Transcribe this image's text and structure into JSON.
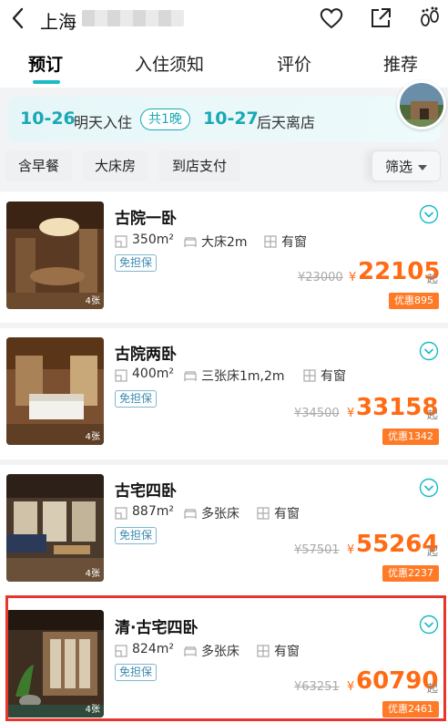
{
  "header": {
    "title": "上海",
    "icons": [
      "back-chevron-icon",
      "heart-icon",
      "share-icon",
      "footprint-icon"
    ]
  },
  "tabs": [
    {
      "label": "预订",
      "active": true
    },
    {
      "label": "入住须知",
      "active": false
    },
    {
      "label": "评价",
      "active": false
    },
    {
      "label": "推荐",
      "active": false
    }
  ],
  "dates": {
    "checkin_date": "10-26",
    "checkin_label": "明天入住",
    "nights": "共1晚",
    "checkout_date": "10-27",
    "checkout_label": "后天离店"
  },
  "filters": {
    "chips": [
      "含早餐",
      "大床房",
      "到店支付"
    ],
    "filter_label": "筛选"
  },
  "accent_color": "#19b9c6",
  "price_color": "#ff6a13",
  "rooms": [
    {
      "name": "古院一卧",
      "area": "350m²",
      "bed": "大床2m",
      "window": "有窗",
      "badge": "免担保",
      "orig_price": "¥23000",
      "currency": "¥",
      "price": "22105",
      "from": "起",
      "discount": "优惠895",
      "photo_count": "4张"
    },
    {
      "name": "古院两卧",
      "area": "400m²",
      "bed": "三张床1m,2m",
      "window": "有窗",
      "badge": "免担保",
      "orig_price": "¥34500",
      "currency": "¥",
      "price": "33158",
      "from": "起",
      "discount": "优惠1342",
      "photo_count": "4张"
    },
    {
      "name": "古宅四卧",
      "area": "887m²",
      "bed": "多张床",
      "window": "有窗",
      "badge": "免担保",
      "orig_price": "¥57501",
      "currency": "¥",
      "price": "55264",
      "from": "起",
      "discount": "优惠2237",
      "photo_count": "4张"
    },
    {
      "name": "清·古宅四卧",
      "area": "824m²",
      "bed": "多张床",
      "window": "有窗",
      "badge": "免担保",
      "orig_price": "¥63251",
      "currency": "¥",
      "price": "60790",
      "from": "起",
      "discount": "优惠2461",
      "photo_count": "4张"
    }
  ]
}
